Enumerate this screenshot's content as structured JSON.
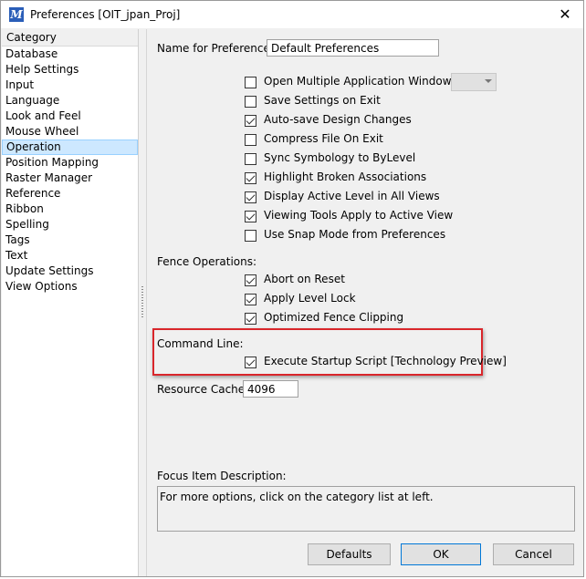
{
  "window": {
    "title": "Preferences [OIT_jpan_Proj]",
    "close_glyph": "✕"
  },
  "category_header": "Category",
  "categories": [
    "Database",
    "Help Settings",
    "Input",
    "Language",
    "Look and Feel",
    "Mouse Wheel",
    "Operation",
    "Position Mapping",
    "Raster Manager",
    "Reference",
    "Ribbon",
    "Spelling",
    "Tags",
    "Text",
    "Update Settings",
    "View Options"
  ],
  "selected_category": "Operation",
  "name_label": "Name for Preferences:",
  "name_value": "Default Preferences",
  "options": [
    {
      "label": "Open Multiple Application Windows",
      "checked": false
    },
    {
      "label": "Save Settings on Exit",
      "checked": false
    },
    {
      "label": "Auto-save Design Changes",
      "checked": true
    },
    {
      "label": "Compress File On Exit",
      "checked": false
    },
    {
      "label": "Sync Symbology to ByLevel",
      "checked": false
    },
    {
      "label": "Highlight Broken Associations",
      "checked": true
    },
    {
      "label": "Display Active Level in All Views",
      "checked": true
    },
    {
      "label": "Viewing Tools Apply to Active View",
      "checked": true
    },
    {
      "label": "Use Snap Mode from Preferences",
      "checked": false
    }
  ],
  "fence_label": "Fence Operations:",
  "fence_options": [
    {
      "label": "Abort on Reset",
      "checked": true
    },
    {
      "label": "Apply Level Lock",
      "checked": true
    },
    {
      "label": "Optimized Fence Clipping",
      "checked": true
    }
  ],
  "command_line_label": "Command Line:",
  "command_line_option": {
    "label": "Execute Startup Script [Technology Preview]",
    "checked": true
  },
  "resource_cache_label": "Resource Cache:",
  "resource_cache_value": "4096",
  "focus_label": "Focus Item Description:",
  "focus_text": "For more options, click on the category list at left.",
  "buttons": {
    "defaults": "Defaults",
    "ok": "OK",
    "cancel": "Cancel"
  },
  "colors": {
    "highlight": "#d9262b",
    "selection": "#cde8ff",
    "accent": "#0078d7"
  }
}
